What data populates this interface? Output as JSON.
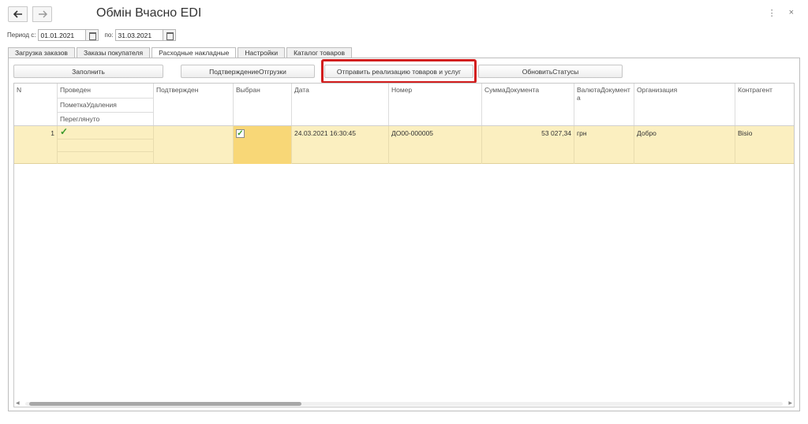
{
  "window": {
    "title": "Обмін Вчасно EDI",
    "back_icon": "arrow-left-icon",
    "forward_icon": "arrow-right-icon",
    "menu_icon": "more-vertical-icon",
    "close_icon": "close-icon",
    "more_glyph": "⋮",
    "close_glyph": "×"
  },
  "period": {
    "from_label": "Период с:",
    "from_value": "01.01.2021",
    "to_label": "по:",
    "to_value": "31.03.2021"
  },
  "tabs": [
    {
      "label": "Загрузка заказов",
      "active": false
    },
    {
      "label": "Заказы покупателя",
      "active": false
    },
    {
      "label": "Расходные накладные",
      "active": true
    },
    {
      "label": "Настройки",
      "active": false
    },
    {
      "label": "Каталог товаров",
      "active": false
    }
  ],
  "toolbar": {
    "fill": "Заполнить",
    "confirm_shipment": "ПодтверждениеОтгрузки",
    "send_sales": "Отправить реализацию товаров и услуг",
    "update_statuses": "ОбновитьСтатусы",
    "highlight_color": "#d21d1d"
  },
  "table": {
    "headers": {
      "n": "N",
      "posted": "Проведен",
      "deletion_mark": "ПометкаУдаления",
      "viewed": "Переглянуто",
      "confirmed": "Подтвержден",
      "selected": "Выбран",
      "date": "Дата",
      "number": "Номер",
      "amount": "СуммаДокумента",
      "currency": "ВалютаДокумента",
      "organization": "Организация",
      "counterparty": "Контрагент"
    },
    "rows": [
      {
        "n": "1",
        "posted": true,
        "selected": true,
        "date": "24.03.2021 16:30:45",
        "number": "ДО00-000005",
        "amount": "53 027,34",
        "currency": "грн",
        "organization": "Добро",
        "counterparty": "Bisio"
      }
    ],
    "check_glyph": "✓"
  }
}
